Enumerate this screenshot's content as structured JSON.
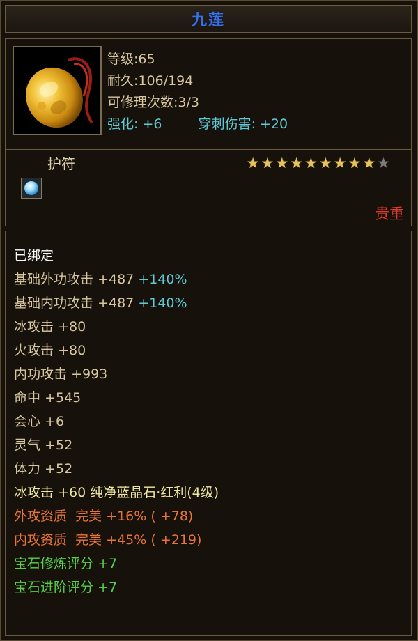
{
  "title": "九莲",
  "item": {
    "level_label": "等级",
    "level": "65",
    "durability_label": "耐久",
    "durability": "106/194",
    "repair_label": "可修理次数",
    "repair": "3/3",
    "enhance_label": "强化:",
    "enhance_value": "+6",
    "pierce_label": "穿刺伤害:",
    "pierce_value": "+20",
    "type": "护符",
    "stars_filled": 9,
    "stars_total": 10,
    "rarity": "贵重",
    "gem_icon": "blue-crystal-gem-icon",
    "image_icon": "golden-amulet-icon"
  },
  "attributes": {
    "bound": "已绑定",
    "lines": [
      {
        "name": "基础外功攻击",
        "value": "+487",
        "pct": "+140%"
      },
      {
        "name": "基础内功攻击",
        "value": "+487",
        "pct": "+140%"
      },
      {
        "name": "冰攻击",
        "value": "+80"
      },
      {
        "name": "火攻击",
        "value": "+80"
      },
      {
        "name": "内功攻击",
        "value": "+993"
      },
      {
        "name": "命中",
        "value": "+545"
      },
      {
        "name": "会心",
        "value": "+6"
      },
      {
        "name": "灵气",
        "value": "+52"
      },
      {
        "name": "体力",
        "value": "+52"
      }
    ],
    "gem_line": {
      "name": "冰攻击",
      "value": "+60",
      "gem": "纯净蓝晶石·红利(4级)"
    },
    "quality": [
      {
        "name": "外攻资质",
        "grade": "完美",
        "pct": "+16%",
        "extra": "( +78)"
      },
      {
        "name": "内攻资质",
        "grade": "完美",
        "pct": "+45%",
        "extra": "( +219)"
      }
    ],
    "scores": [
      {
        "name": "宝石修炼评分",
        "value": "+7"
      },
      {
        "name": "宝石进阶评分",
        "value": "+7"
      }
    ]
  },
  "colors": {
    "title": "#3c6fe0",
    "cyan": "#5fc9d6",
    "orange": "#e8743a",
    "green": "#58d04a",
    "rarity": "#e03a2a"
  }
}
